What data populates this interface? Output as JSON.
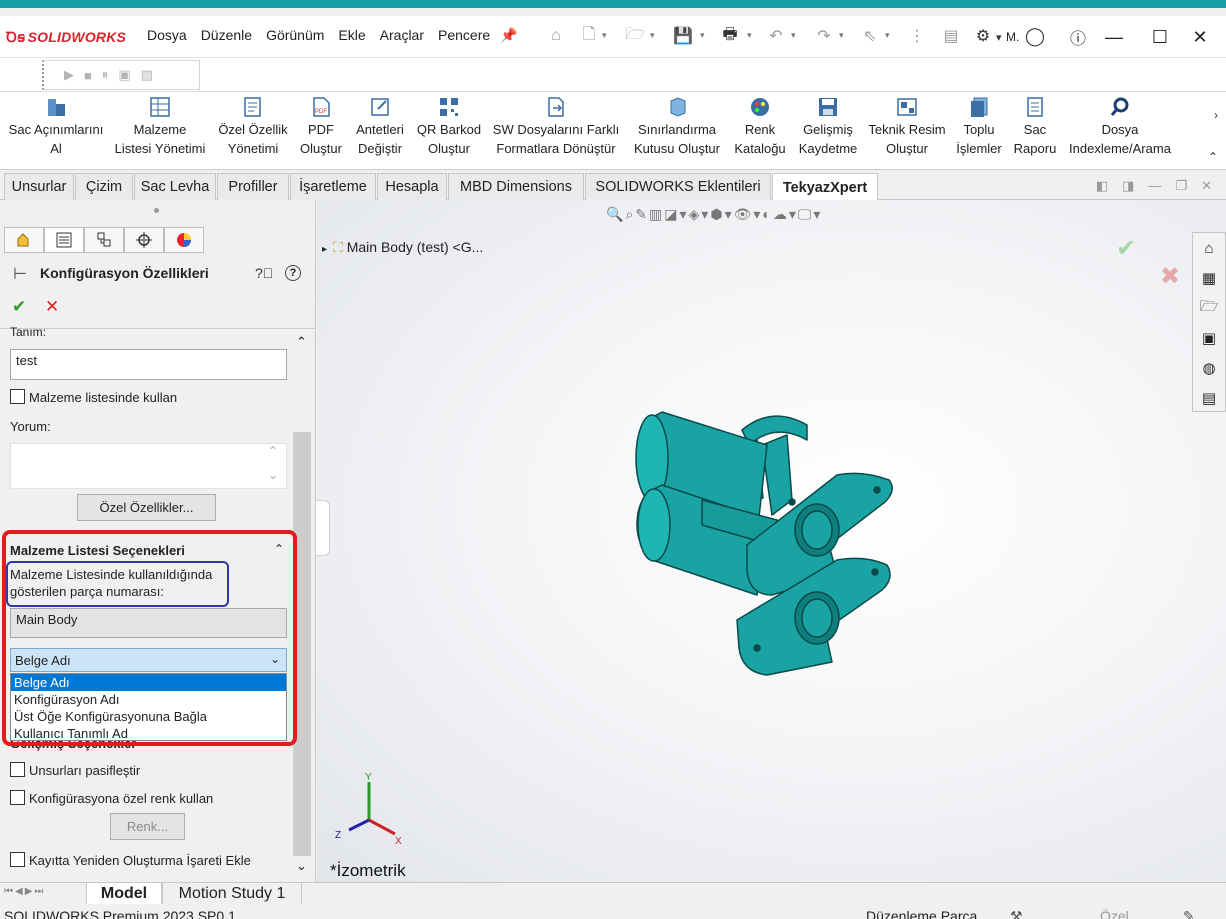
{
  "app": {
    "logo": "SOLIDWORKS",
    "menu": [
      "Dosya",
      "Düzenle",
      "Görünüm",
      "Ekle",
      "Araçlar",
      "Pencere"
    ],
    "user_label": "M.",
    "accent": "#1a9ea6"
  },
  "commands": [
    {
      "label": "Sac Açınımlarını\nAl",
      "icon": "sheet-flatten-icon"
    },
    {
      "label": "Malzeme\nListesi Yönetimi",
      "icon": "bom-table-icon"
    },
    {
      "label": "Özel Özellik\nYönetimi",
      "icon": "custom-property-icon"
    },
    {
      "label": "PDF\nOluştur",
      "icon": "pdf-icon"
    },
    {
      "label": "Antetleri\nDeğiştir",
      "icon": "titleblock-icon"
    },
    {
      "label": "QR Barkod\nOluştur",
      "icon": "qr-icon"
    },
    {
      "label": "SW Dosyalarını Farklı\nFormatlara Dönüştür",
      "icon": "convert-icon"
    },
    {
      "label": "Sınırlandırma\nKutusu Oluştur",
      "icon": "bounding-box-icon"
    },
    {
      "label": "Renk\nKataloğu",
      "icon": "palette-icon"
    },
    {
      "label": "Gelişmiş\nKaydetme",
      "icon": "save-icon"
    },
    {
      "label": "Teknik Resim\nOluştur",
      "icon": "drawing-icon"
    },
    {
      "label": "Toplu\nİşlemler",
      "icon": "batch-icon"
    },
    {
      "label": "Sac\nRaporu",
      "icon": "sheet-report-icon"
    },
    {
      "label": "Dosya\nIndexleme/Arama",
      "icon": "search-icon"
    }
  ],
  "tabs": [
    "Unsurlar",
    "Çizim",
    "Sac Levha",
    "Profiller",
    "İşaretleme",
    "Hesapla",
    "MBD Dimensions",
    "SOLIDWORKS Eklentileri",
    "TekyazXpert"
  ],
  "active_tab": "TekyazXpert",
  "panel": {
    "title": "Konfigürasyon Özellikleri",
    "tanim_label": "Tanım:",
    "tanim_value": "test",
    "bom_check": "Malzeme listesinde kullan",
    "yorum_label": "Yorum:",
    "custom_props_btn": "Özel Özellikler...",
    "bom_section": "Malzeme Listesi Seçenekleri",
    "bom_desc_1": "Malzeme Listesinde kullanıldığında",
    "bom_desc_2": "gösterilen parça numarası:",
    "part_number": "Main Body",
    "dropdown_value": "Belge Adı",
    "dropdown_options": [
      "Belge Adı",
      "Konfigürasyon Adı",
      "Üst Öğe Konfigürasyonuna Bağla",
      "Kullanıcı Tanımlı Ad"
    ],
    "advanced_section": "Gelişmiş Seçenekler",
    "suppress_check": "Unsurları pasifleştir",
    "color_check": "Konfigürasyona özel renk kullan",
    "color_btn": "Renk...",
    "rebuild_check": "Kayıtta Yeniden Oluşturma İşareti Ekle"
  },
  "viewport": {
    "tree_item": "Main Body (test) <G...",
    "view_label": "*İzometrik",
    "part_color": "#1aa3a3"
  },
  "bottom_tabs": [
    "Model",
    "Motion Study 1"
  ],
  "status": {
    "left": "SOLIDWORKS Premium 2023 SP0.1",
    "mode": "Düzenleme Parça",
    "units": "Özel"
  }
}
